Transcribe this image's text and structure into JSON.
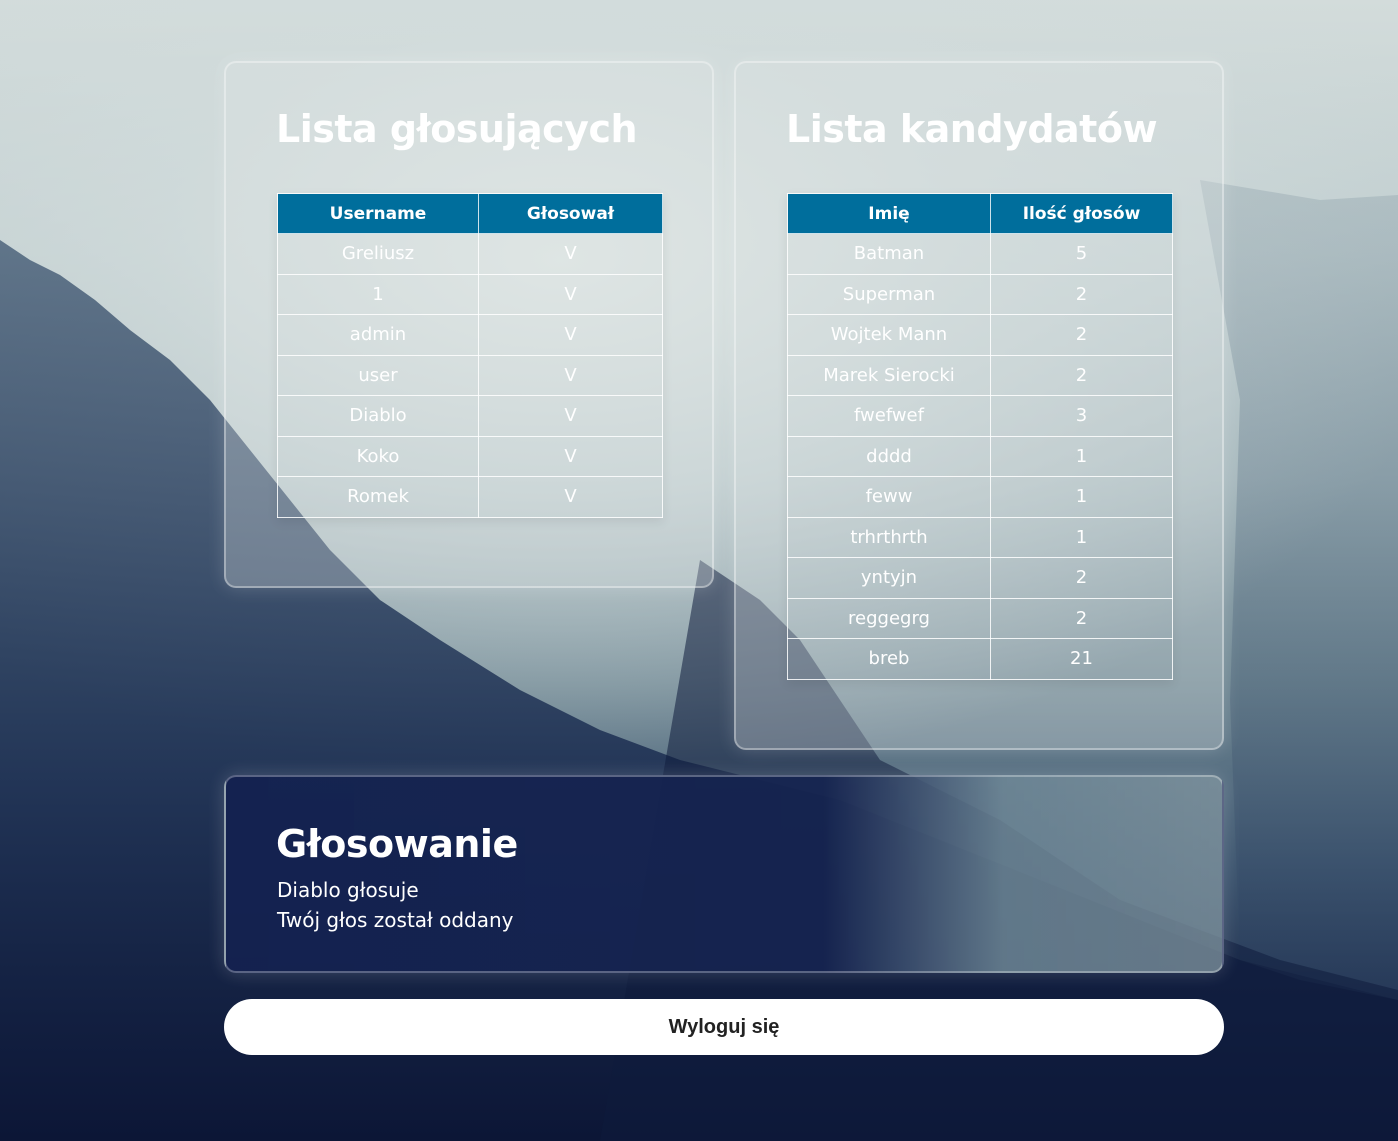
{
  "voters": {
    "title": "Lista głosujących",
    "columns": [
      "Username",
      "Głosował"
    ],
    "rows": [
      [
        "Greliusz",
        "V"
      ],
      [
        "1",
        "V"
      ],
      [
        "admin",
        "V"
      ],
      [
        "user",
        "V"
      ],
      [
        "Diablo",
        "V"
      ],
      [
        "Koko",
        "V"
      ],
      [
        "Romek",
        "V"
      ]
    ]
  },
  "candidates": {
    "title": "Lista kandydatów",
    "columns": [
      "Imię",
      "Ilość głosów"
    ],
    "rows": [
      [
        "Batman",
        "5"
      ],
      [
        "Superman",
        "2"
      ],
      [
        "Wojtek Mann",
        "2"
      ],
      [
        "Marek Sierocki",
        "2"
      ],
      [
        "fwefwef",
        "3"
      ],
      [
        "dddd",
        "1"
      ],
      [
        "feww",
        "1"
      ],
      [
        "trhrthrth",
        "1"
      ],
      [
        "yntyjn",
        "2"
      ],
      [
        "reggegrg",
        "2"
      ],
      [
        "breb",
        "21"
      ]
    ]
  },
  "voting": {
    "title": "Głosowanie",
    "line1": "Diablo głosuje",
    "line2": "Twój głos został oddany"
  },
  "logout": {
    "label": "Wyloguj się"
  },
  "colors": {
    "table_header": "#006e9c",
    "voting_panel": "#142250"
  }
}
